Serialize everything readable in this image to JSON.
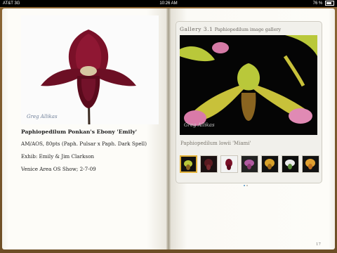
{
  "status_bar": {
    "carrier": "AT&T 3G",
    "time": "10:26 AM",
    "battery": "76 %",
    "battery_level": 0.76
  },
  "left_page": {
    "image_alt": "Paphiopedilum Ponkan's Ebony 'Emily' photo",
    "signature": "Greg Allikas",
    "title": "Paphiopedilum Ponkan's Ebony 'Emily'",
    "lines": [
      "AM/AOS, 80pts (Paph. Pulsar x Paph. Dark Spell)",
      "Exhib: Emily & Jim Clarkson",
      "Venice Area OS Show; 2-7-09"
    ]
  },
  "gallery": {
    "label": "Gallery 3.1",
    "subtitle": "Paphiopedilum image gallery",
    "signature": "Greg Allikas",
    "caption": "Paphiopedilum lowii 'Miami'",
    "thumbnail_count": 7,
    "selected_index": 0,
    "page_dots": 2,
    "active_dot": 0
  },
  "page_number": "17",
  "colors": {
    "cover": "#7a5a2e",
    "selection": "#e2b23a",
    "active_dot": "#4a8ec2"
  }
}
